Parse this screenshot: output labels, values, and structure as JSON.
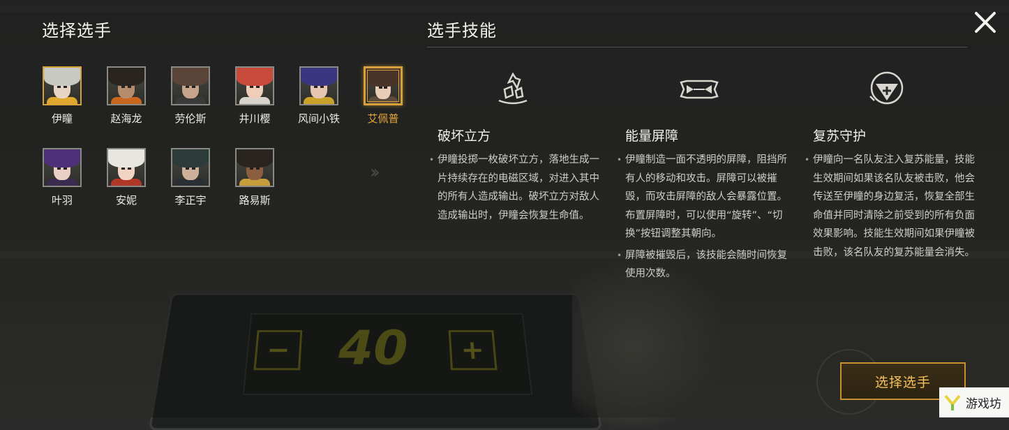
{
  "titles": {
    "select_player": "选择选手",
    "player_skills": "选手技能"
  },
  "heroes": [
    {
      "name": "伊瞳",
      "hair": "#c9c9c4",
      "skin": "#e7d4c4",
      "body": "#e0a62e",
      "selected": false,
      "highlight": true
    },
    {
      "name": "赵海龙",
      "hair": "#2a2420",
      "skin": "#b58c6c",
      "body": "#c9671f",
      "selected": false
    },
    {
      "name": "劳伦斯",
      "hair": "#5a4438",
      "skin": "#c7a48c",
      "body": "#3a3a3a",
      "selected": false
    },
    {
      "name": "井川樱",
      "hair": "#c84a3a",
      "skin": "#f0cdb8",
      "body": "#d8d4cc",
      "selected": false
    },
    {
      "name": "风间小铁",
      "hair": "#3b3680",
      "skin": "#e6c6b0",
      "body": "#caa22a",
      "selected": false
    },
    {
      "name": "艾佩普",
      "hair": "#4a3328",
      "skin": "#e9ccb8",
      "body": "#5d4a3c",
      "selected": true
    },
    {
      "name": "叶羽",
      "hair": "#4e2f78",
      "skin": "#ead0c4",
      "body": "#3a2c50",
      "selected": false
    },
    {
      "name": "安妮",
      "hair": "#e8e6e0",
      "skin": "#f1d4c2",
      "body": "#b03628",
      "selected": false
    },
    {
      "name": "李正宇",
      "hair": "#2d3a3a",
      "skin": "#cfb09a",
      "body": "#2a2f33",
      "selected": false
    },
    {
      "name": "路易斯",
      "hair": "#2a2420",
      "skin": "#8a5e3e",
      "body": "#c59d3a",
      "selected": false
    }
  ],
  "skills": [
    {
      "icon": "shatter-cube-icon",
      "name": "破坏立方",
      "desc": [
        "伊瞳投掷一枚破坏立方，落地生成一片持续存在的电磁区域，对进入其中的所有人造成输出。破坏立方对敌人造成输出时，伊瞳会恢复生命值。"
      ]
    },
    {
      "icon": "energy-barrier-icon",
      "name": "能量屏障",
      "desc": [
        "伊瞳制造一面不透明的屏障，阻挡所有人的移动和攻击。屏障可以被摧毁，而攻击屏障的敌人会暴露位置。布置屏障时，可以使用“旋转”、“切换”按钮调整其朝向。",
        "屏障被摧毁后，该技能会随时间恢复使用次数。"
      ]
    },
    {
      "icon": "revive-guard-icon",
      "name": "复苏守护",
      "desc": [
        "伊瞳向一名队友注入复苏能量，技能生效期间如果该名队友被击败，他会传送至伊瞳的身边复活，恢复全部生命值并同时清除之前受到的所有负面效果影响。技能生效期间如果伊瞳被击败，该名队友的复苏能量会消失。"
      ]
    }
  ],
  "background": {
    "console_value": "40",
    "console_minus": "−",
    "console_plus": "+",
    "chevrons": "››"
  },
  "confirm_button": "选择选手",
  "watermark": "游戏坊",
  "colors": {
    "accent_gold": "#d6a13a",
    "selected_name": "#e3a436"
  }
}
